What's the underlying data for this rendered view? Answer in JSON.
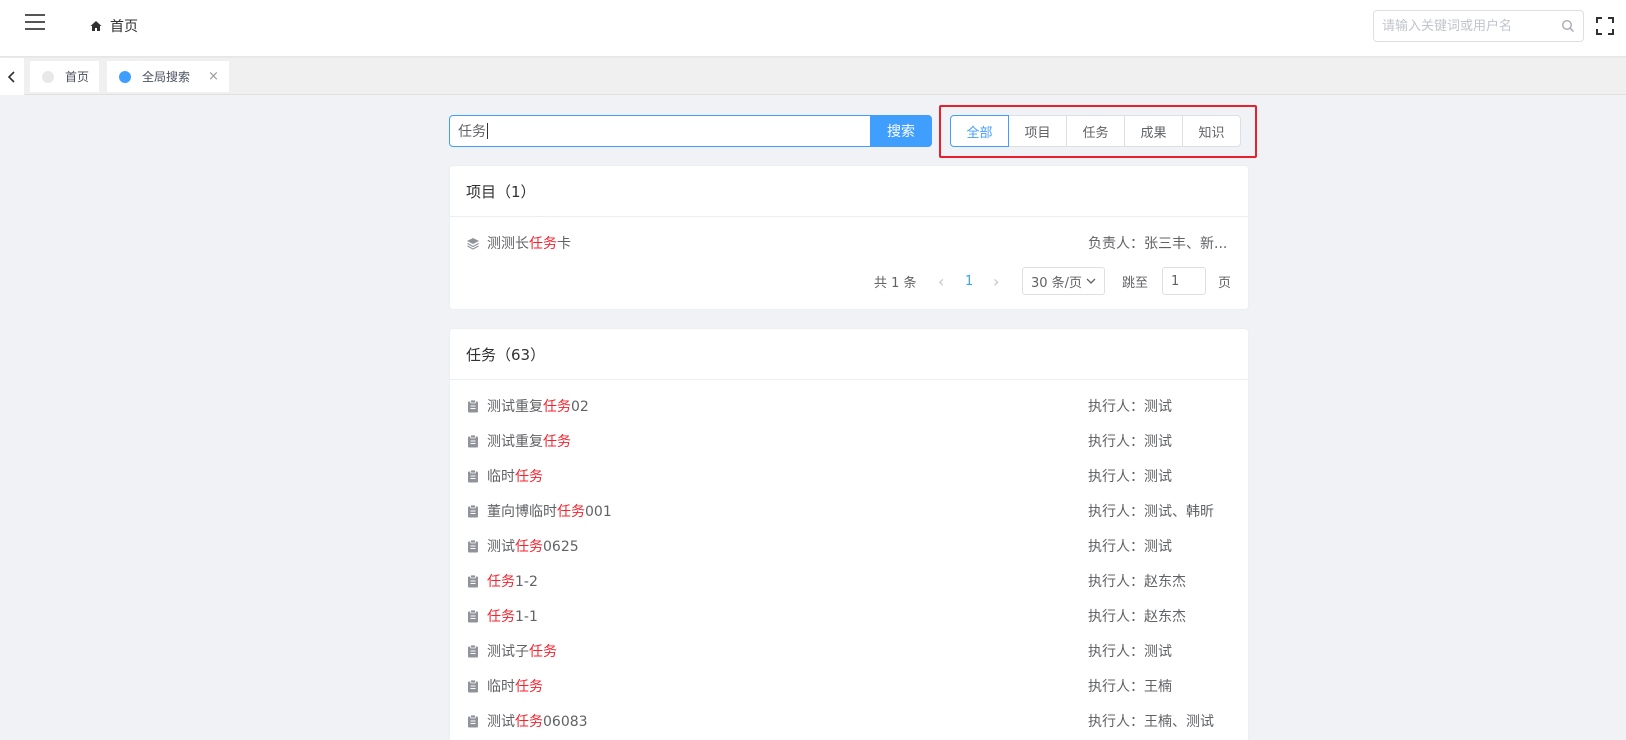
{
  "header": {
    "breadcrumb_home": "首页",
    "search_placeholder": "请输入关键词或用户名"
  },
  "tabs": [
    {
      "label": "首页",
      "dot_color": "#e8e8e8"
    },
    {
      "label": "全局搜索",
      "dot_color": "#409eff",
      "close": "×"
    }
  ],
  "search": {
    "query": "任务",
    "button_label": "搜索"
  },
  "filters": [
    "全部",
    "项目",
    "任务",
    "成果",
    "知识"
  ],
  "colors": {
    "accent": "#409eff",
    "highlight": "#f5222d",
    "callout": "#e6202e"
  },
  "projects": {
    "title": "项目（1）",
    "items": [
      {
        "pre": "测测长",
        "hl": "任务",
        "post": "卡",
        "meta": "负责人：张三丰、新..."
      }
    ],
    "pager": {
      "total": "共 1 条",
      "prev": "‹",
      "page": "1",
      "next": "›",
      "size": "30 条/页",
      "goto": "跳至",
      "goto_value": "1",
      "page_unit": "页"
    }
  },
  "tasks": {
    "title": "任务（63）",
    "items": [
      {
        "pre": "测试重复",
        "hl": "任务",
        "post": "02",
        "meta": "执行人：测试"
      },
      {
        "pre": "测试重复",
        "hl": "任务",
        "post": "",
        "meta": "执行人：测试"
      },
      {
        "pre": "临时",
        "hl": "任务",
        "post": "",
        "meta": "执行人：测试"
      },
      {
        "pre": "董向博临时",
        "hl": "任务",
        "post": "001",
        "meta": "执行人：测试、韩昕"
      },
      {
        "pre": "测试",
        "hl": "任务",
        "post": "0625",
        "meta": "执行人：测试"
      },
      {
        "pre": "",
        "hl": "任务",
        "post": "1-2",
        "meta": "执行人：赵东杰"
      },
      {
        "pre": "",
        "hl": "任务",
        "post": "1-1",
        "meta": "执行人：赵东杰"
      },
      {
        "pre": "测试子",
        "hl": "任务",
        "post": "",
        "meta": "执行人：测试"
      },
      {
        "pre": "临时",
        "hl": "任务",
        "post": "",
        "meta": "执行人：王楠"
      },
      {
        "pre": "测试",
        "hl": "任务",
        "post": "06083",
        "meta": "执行人：王楠、测试"
      }
    ]
  }
}
